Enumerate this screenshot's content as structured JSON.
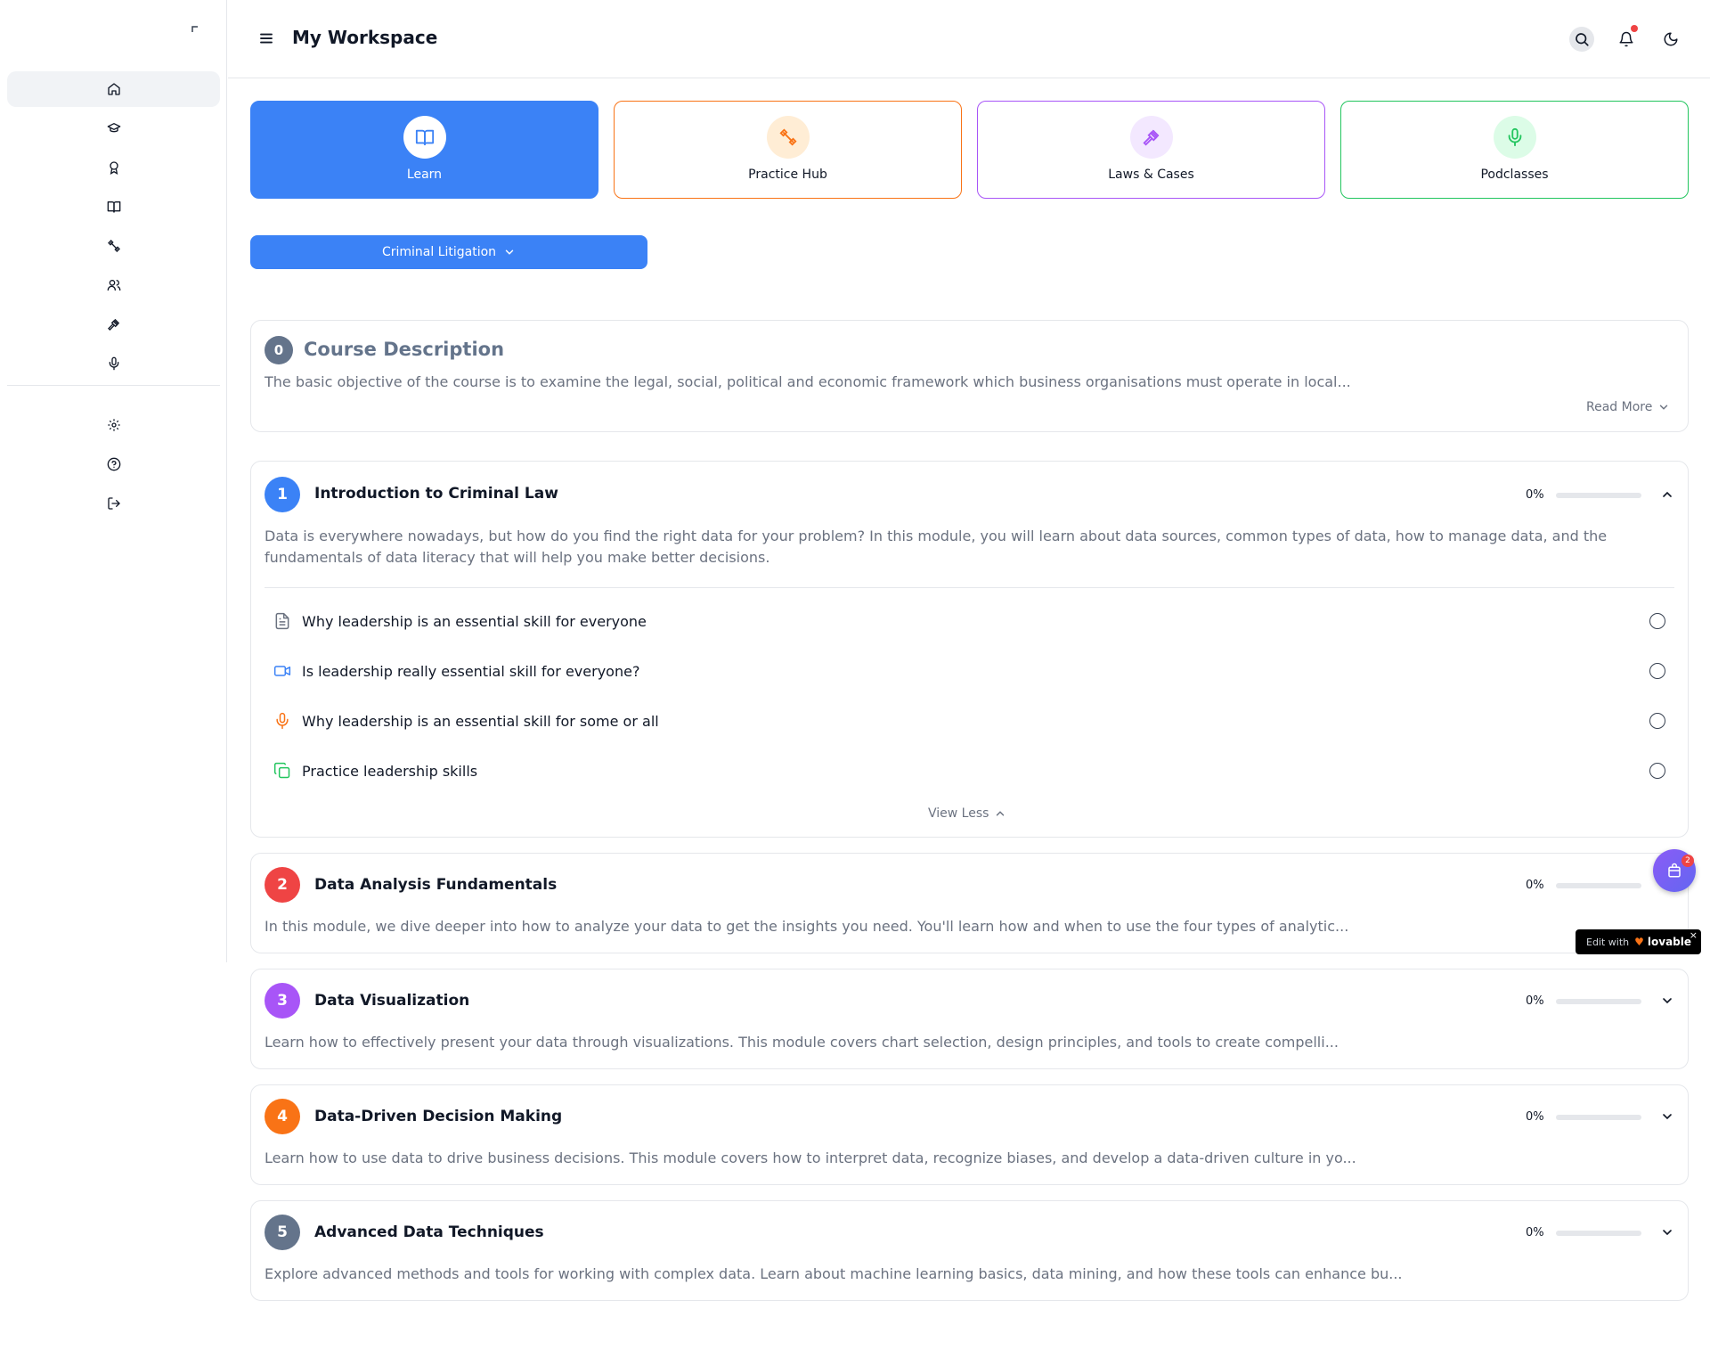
{
  "header": {
    "title": "My Workspace"
  },
  "sidebar": {
    "top_items": [
      {
        "name": "home-icon"
      },
      {
        "name": "graduation-cap-icon"
      },
      {
        "name": "award-icon"
      },
      {
        "name": "book-open-icon"
      },
      {
        "name": "dumbbell-icon"
      },
      {
        "name": "users-icon"
      },
      {
        "name": "gavel-icon"
      },
      {
        "name": "mic-icon"
      }
    ],
    "bottom_items": [
      {
        "name": "settings-icon"
      },
      {
        "name": "help-icon"
      },
      {
        "name": "logout-icon"
      }
    ]
  },
  "tiles": [
    {
      "label": "Learn",
      "color": "#3b82f6"
    },
    {
      "label": "Practice Hub",
      "color": "#f97316"
    },
    {
      "label": "Laws & Cases",
      "color": "#a855f7"
    },
    {
      "label": "Podclasses",
      "color": "#22c55e"
    }
  ],
  "course_select": {
    "value": "Criminal Litigation"
  },
  "description": {
    "number": "0",
    "title": "Course Description",
    "text": "The basic objective of the course is to examine the legal, social, political and economic framework which business organisations must operate in local...",
    "read_more": "Read More"
  },
  "modules": [
    {
      "number": "1",
      "title": "Introduction to Criminal Law",
      "progress": "0%",
      "progress_value": 0,
      "color": "#3b82f6",
      "text": "Data is everywhere nowadays, but how do you find the right data for your problem? In this module, you will learn about data sources, common types of data, how to manage data, and the fundamentals of data literacy that will help you make better decisions.",
      "lessons": [
        {
          "title": "Why leadership is an essential skill for everyone",
          "icon": "document-icon"
        },
        {
          "title": "Is leadership really essential skill for everyone?",
          "icon": "video-icon"
        },
        {
          "title": "Why leadership is an essential skill for some or all",
          "icon": "mic-icon"
        },
        {
          "title": "Practice leadership skills",
          "icon": "copy-icon"
        }
      ],
      "view_less": "View Less"
    },
    {
      "number": "2",
      "title": "Data Analysis Fundamentals",
      "progress": "0%",
      "progress_value": 0,
      "color": "#ef4444",
      "text": "In this module, we dive deeper into how to analyze your data to get the insights you need. You'll learn how and when to use the four types of analytic..."
    },
    {
      "number": "3",
      "title": "Data Visualization",
      "progress": "0%",
      "progress_value": 0,
      "color": "#a855f7",
      "text": "Learn how to effectively present your data through visualizations. This module covers chart selection, design principles, and tools to create compelli..."
    },
    {
      "number": "4",
      "title": "Data-Driven Decision Making",
      "progress": "0%",
      "progress_value": 0,
      "color": "#f97316",
      "text": "Learn how to use data to drive business decisions. This module covers how to interpret data, recognize biases, and develop a data-driven culture in yo..."
    },
    {
      "number": "5",
      "title": "Advanced Data Techniques",
      "progress": "0%",
      "progress_value": 0,
      "color": "#64748b",
      "text": "Explore advanced methods and tools for working with complex data. Learn about machine learning basics, data mining, and how these tools can enhance bu..."
    }
  ],
  "fab": {
    "badge": "2"
  },
  "lovable_badge": {
    "edit_text": "Edit with",
    "brand": "lovable",
    "close": "×"
  }
}
